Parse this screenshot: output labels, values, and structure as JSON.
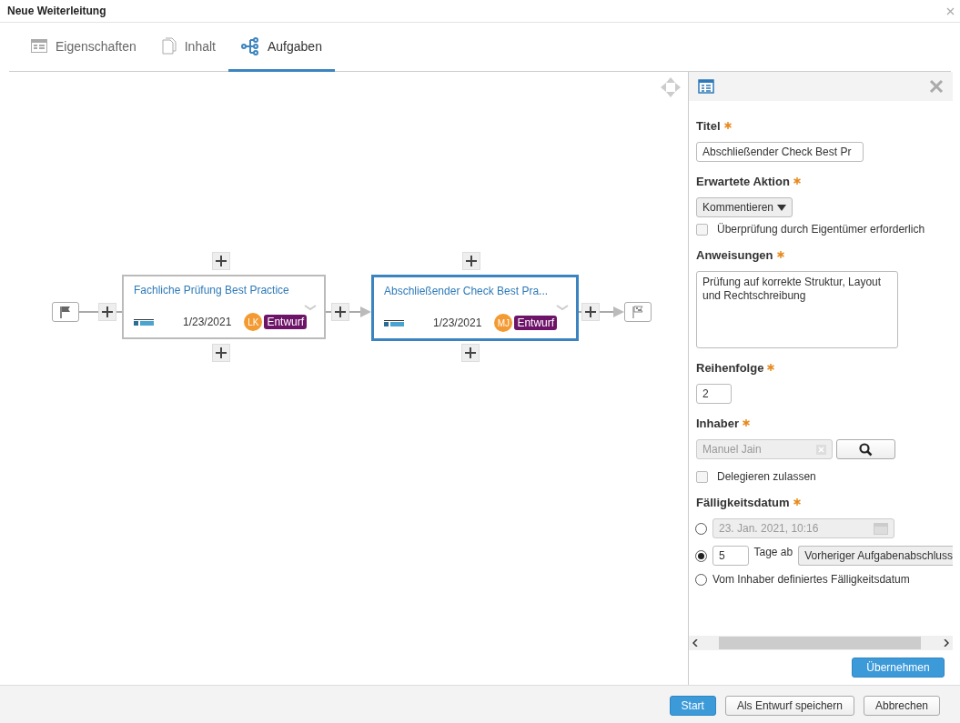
{
  "window": {
    "title": "Neue Weiterleitung"
  },
  "tabs": [
    {
      "label": "Eigenschaften",
      "selected": false,
      "kind": "table"
    },
    {
      "label": "Inhalt",
      "selected": false,
      "kind": "pages"
    },
    {
      "label": "Aufgaben",
      "selected": true,
      "kind": "flow"
    }
  ],
  "tasks": [
    {
      "title": "Fachliche Prüfung Best Practice",
      "date": "1/23/2021",
      "initials": "LK",
      "status": "Entwurf",
      "selected": false
    },
    {
      "title": "Abschließender Check Best Pra...",
      "date": "1/23/2021",
      "initials": "MJ",
      "status": "Entwurf",
      "selected": true
    }
  ],
  "panel": {
    "title_label": "Titel",
    "title_value": "Abschließender Check Best Pr",
    "action_label": "Erwartete Aktion",
    "action_value": "Kommentieren",
    "review_checkbox": {
      "label": "Überprüfung durch Eigentümer erforderlich",
      "checked": false
    },
    "instructions_label": "Anweisungen",
    "instructions_value": "Prüfung auf korrekte Struktur, Layout und Rechtschreibung",
    "order_label": "Reihenfolge",
    "order_value": "2",
    "owner_label": "Inhaber",
    "owner_value": "Manuel Jain",
    "delegate_checkbox": {
      "label": "Delegieren zulassen",
      "checked": false
    },
    "due_label": "Fälligkeitsdatum",
    "due_options": [
      {
        "kind": "date",
        "value": "23. Jan. 2021, 10:16",
        "selected": false
      },
      {
        "kind": "days",
        "value": "5",
        "text": "Tage ab",
        "select": "Vorheriger Aufgabenabschluss",
        "selected": true
      },
      {
        "kind": "text",
        "text": "Vom Inhaber definiertes Fälligkeitsdatum",
        "selected": false
      }
    ],
    "apply_button": "Übernehmen"
  },
  "footer_buttons": [
    {
      "label": "Start",
      "primary": true
    },
    {
      "label": "Als Entwurf speichern",
      "primary": false
    },
    {
      "label": "Abbrechen",
      "primary": false
    }
  ]
}
